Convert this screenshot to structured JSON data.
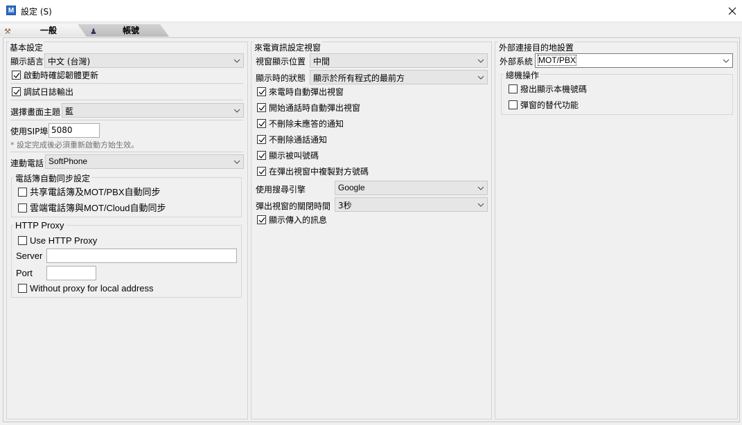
{
  "window": {
    "title": "設定 (S)",
    "icon_letter": "M"
  },
  "tabs": [
    {
      "label": "一般"
    },
    {
      "label": "帳號"
    }
  ],
  "basic": {
    "title": "基本設定",
    "language_label": "顯示語言",
    "language_value": "中文 (台灣)",
    "check_update_label": "啟動時確認韌體更新",
    "check_update_checked": true,
    "debug_log_label": "調試日誌輸出",
    "debug_log_checked": true,
    "theme_label": "選擇畫面主題",
    "theme_value": "藍",
    "sip_port_label": "使用SIP埠",
    "sip_port_value": "5080",
    "sip_note": "* 設定完成後必須重新啟動方始生效。",
    "link_phone_label": "連動電話",
    "link_phone_value": "SoftPhone",
    "phonebook_sync": {
      "title": "電話簿自動同步設定",
      "shared_label": "共享電話簿及MOT/PBX自動同步",
      "shared_checked": false,
      "cloud_label": "雲端電話簿與MOT/Cloud自動同步",
      "cloud_checked": false
    },
    "http_proxy": {
      "title": "HTTP Proxy",
      "use_label": "Use HTTP Proxy",
      "use_checked": false,
      "server_label": "Server",
      "server_value": "",
      "port_label": "Port",
      "port_value": "",
      "without_label": "Without proxy for local address",
      "without_checked": false
    }
  },
  "incoming": {
    "title": "來電資訊設定視窗",
    "position_label": "視窗顯示位置",
    "position_value": "中間",
    "display_state_label": "顯示時的狀態",
    "display_state_value": "顯示於所有程式的最前方",
    "options": [
      {
        "label": "來電時自動彈出視窗",
        "checked": true
      },
      {
        "label": "開始通話時自動彈出視窗",
        "checked": true
      },
      {
        "label": "不刪除未應答的通知",
        "checked": true
      },
      {
        "label": "不刪除通話通知",
        "checked": true
      },
      {
        "label": "顯示被叫號碼",
        "checked": true
      },
      {
        "label": "在彈出視窗中複製對方號碼",
        "checked": true
      }
    ],
    "search_engine_label": "使用搜尋引擎",
    "search_engine_value": "Google",
    "close_time_label": "彈出視窗的關閉時間",
    "close_time_value": "3秒",
    "show_message_label": "顯示傳入的訊息",
    "show_message_checked": true
  },
  "external": {
    "title": "外部連接目的地設置",
    "system_label": "外部系統",
    "system_value": "MOT/PBX",
    "general_ops": {
      "title": "總機操作",
      "show_local_label": "撥出顯示本機號碼",
      "show_local_checked": false,
      "popup_alt_label": "彈窗的替代功能",
      "popup_alt_checked": false
    }
  }
}
